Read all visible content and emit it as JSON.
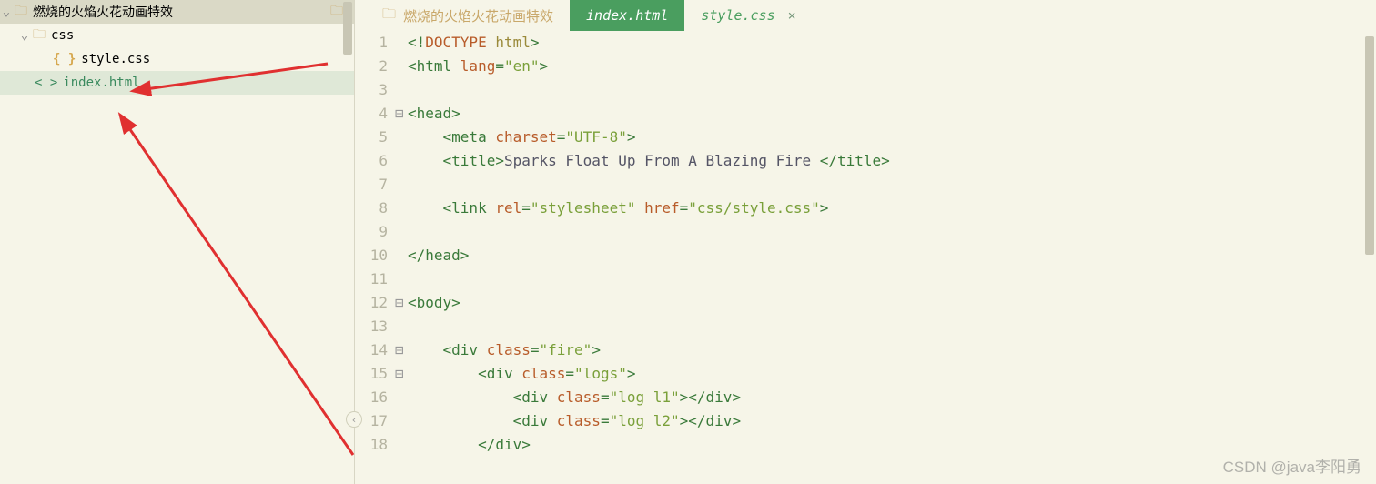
{
  "sidebar": {
    "project_root": "燃烧的火焰火花动画特效",
    "css_folder": "css",
    "style_file": "style.css",
    "index_file": "index.html"
  },
  "tabs": {
    "project_label": "燃烧的火焰火花动画特效",
    "active": "index.html",
    "inactive": "style.css"
  },
  "code": {
    "lines": [
      {
        "n": "1",
        "fold": "",
        "html": "<span class='c-tag'>&lt;!</span><span class='c-rust'>DOCTYPE </span><span class='c-attr'>html</span><span class='c-tag'>&gt;</span>"
      },
      {
        "n": "2",
        "fold": "",
        "html": "<span class='c-tag'>&lt;html </span><span class='c-rust'>lang</span><span class='c-tag'>=</span><span class='c-str'>\"en\"</span><span class='c-tag'>&gt;</span>"
      },
      {
        "n": "3",
        "fold": "",
        "html": ""
      },
      {
        "n": "4",
        "fold": "⊟",
        "html": "<span class='c-tag'>&lt;head&gt;</span>"
      },
      {
        "n": "5",
        "fold": "",
        "html": "    <span class='c-tag'>&lt;meta </span><span class='c-rust'>charset</span><span class='c-tag'>=</span><span class='c-str'>\"UTF-8\"</span><span class='c-tag'>&gt;</span>"
      },
      {
        "n": "6",
        "fold": "",
        "html": "    <span class='c-tag'>&lt;title&gt;</span>Sparks Float Up From A Blazing Fire <span class='c-tag'>&lt;/title&gt;</span>"
      },
      {
        "n": "7",
        "fold": "",
        "html": ""
      },
      {
        "n": "8",
        "fold": "",
        "html": "    <span class='c-tag'>&lt;link </span><span class='c-rust'>rel</span><span class='c-tag'>=</span><span class='c-str'>\"stylesheet\"</span> <span class='c-rust'>href</span><span class='c-tag'>=</span><span class='c-str'>\"css/style.css\"</span><span class='c-tag'>&gt;</span>"
      },
      {
        "n": "9",
        "fold": "",
        "html": ""
      },
      {
        "n": "10",
        "fold": "",
        "html": "<span class='c-tag'>&lt;/head&gt;</span>"
      },
      {
        "n": "11",
        "fold": "",
        "html": ""
      },
      {
        "n": "12",
        "fold": "⊟",
        "html": "<span class='c-tag'>&lt;body&gt;</span>"
      },
      {
        "n": "13",
        "fold": "",
        "html": ""
      },
      {
        "n": "14",
        "fold": "⊟",
        "html": "    <span class='c-tag'>&lt;div </span><span class='c-rust'>class</span><span class='c-tag'>=</span><span class='c-str'>\"fire\"</span><span class='c-tag'>&gt;</span>"
      },
      {
        "n": "15",
        "fold": "⊟",
        "html": "        <span class='c-tag'>&lt;div </span><span class='c-rust'>class</span><span class='c-tag'>=</span><span class='c-str'>\"logs\"</span><span class='c-tag'>&gt;</span>"
      },
      {
        "n": "16",
        "fold": "",
        "html": "            <span class='c-tag'>&lt;div </span><span class='c-rust'>class</span><span class='c-tag'>=</span><span class='c-str'>\"log l1\"</span><span class='c-tag'>&gt;&lt;/div&gt;</span>"
      },
      {
        "n": "17",
        "fold": "",
        "html": "            <span class='c-tag'>&lt;div </span><span class='c-rust'>class</span><span class='c-tag'>=</span><span class='c-str'>\"log l2\"</span><span class='c-tag'>&gt;&lt;/div&gt;</span>"
      },
      {
        "n": "18",
        "fold": "",
        "html": "        <span class='c-tag'>&lt;/div&gt;</span>"
      }
    ]
  },
  "watermark": "CSDN @java李阳勇"
}
